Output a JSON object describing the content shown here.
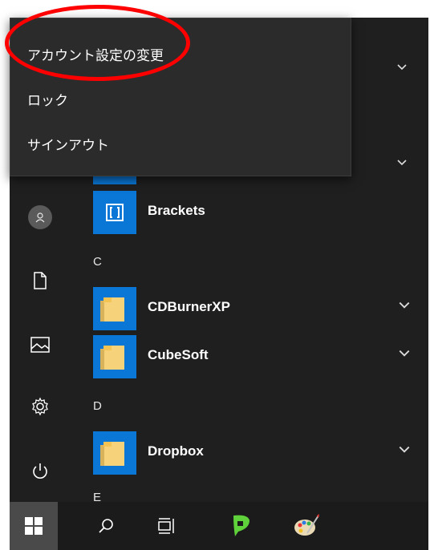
{
  "flyout": {
    "items": [
      {
        "label": "アカウント設定の変更",
        "icon": "none"
      },
      {
        "label": "ロック",
        "icon": "none"
      },
      {
        "label": "サインアウト",
        "icon": "none"
      }
    ]
  },
  "rail": {
    "items": [
      {
        "name": "user-avatar",
        "icon": "person-icon"
      },
      {
        "name": "documents",
        "icon": "document-icon"
      },
      {
        "name": "pictures",
        "icon": "picture-icon"
      },
      {
        "name": "settings",
        "icon": "gear-icon"
      },
      {
        "name": "power",
        "icon": "power-icon"
      }
    ]
  },
  "app_list": {
    "apps": [
      {
        "label": "Brackets",
        "icon": "brackets-icon",
        "expandable": false
      },
      {
        "label": "CDBurnerXP",
        "icon": "folder-icon",
        "expandable": true
      },
      {
        "label": "CubeSoft",
        "icon": "folder-icon",
        "expandable": true
      },
      {
        "label": "Dropbox",
        "icon": "folder-icon",
        "expandable": true
      }
    ],
    "letters": [
      "C",
      "D",
      "E"
    ]
  },
  "taskbar": {
    "items": [
      {
        "name": "start-button",
        "icon": "windows-logo-icon"
      },
      {
        "name": "search-button",
        "icon": "search-icon"
      },
      {
        "name": "task-view-button",
        "icon": "task-view-icon"
      },
      {
        "name": "app-green-pin",
        "icon": "green-pin-icon"
      },
      {
        "name": "app-paint",
        "icon": "palette-icon"
      }
    ]
  },
  "colors": {
    "menu_bg": "#1f1f1f",
    "flyout_bg": "#2b2b2b",
    "tile_blue": "#0a77d6",
    "highlight_red": "#ff0000"
  }
}
